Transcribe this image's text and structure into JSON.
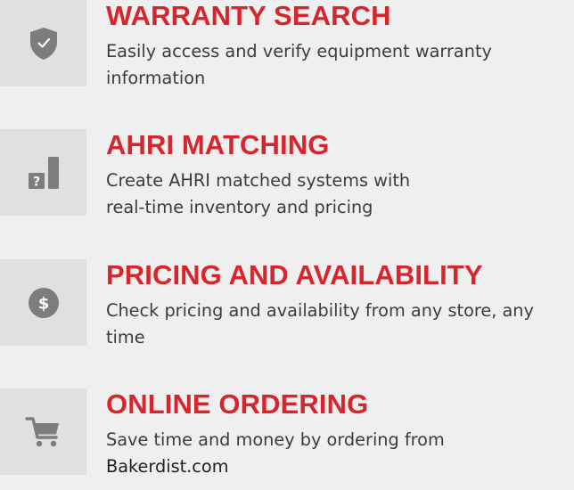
{
  "colors": {
    "title": "#d6262d",
    "text": "#3c3c3c",
    "icon": "#7d7d7d",
    "icon_box": "#e0e0e0",
    "background": "#efefef"
  },
  "features": [
    {
      "icon": "shield-check-icon",
      "title": "WARRANTY SEARCH",
      "description": "Easily access and verify equipment warranty information"
    },
    {
      "icon": "bar-chart-question-icon",
      "title": "AHRI MATCHING",
      "description_line1": "Create AHRI matched systems with",
      "description_line2": "real-time inventory and pricing"
    },
    {
      "icon": "dollar-circle-icon",
      "title": "PRICING AND AVAILABILITY",
      "description": "Check pricing and availability from any store, any time"
    },
    {
      "icon": "shopping-cart-icon",
      "title": "ONLINE ORDERING",
      "description_line1": "Save time and money by ordering from",
      "link": "Bakerdist.com"
    }
  ]
}
